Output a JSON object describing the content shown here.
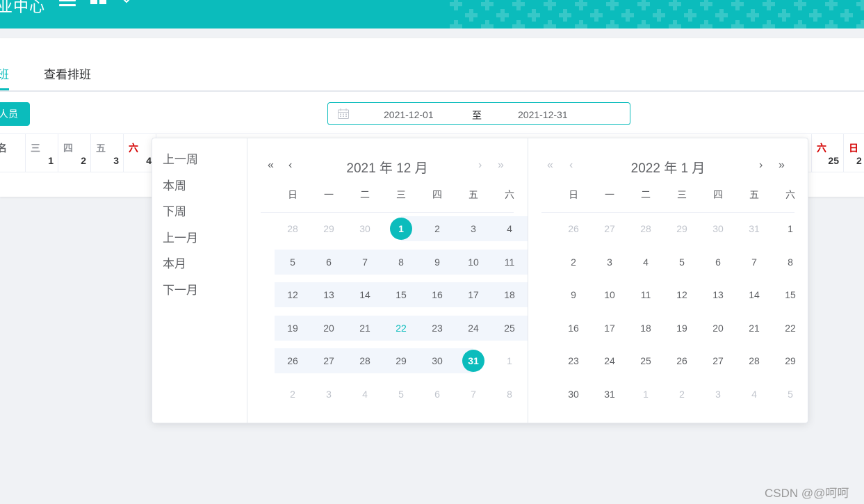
{
  "header": {
    "title": "业中心",
    "menu_icon": "hamburger-menu-icon",
    "grid_icon": "grid-layout-icon",
    "dropdown_icon": "chevron-down-icon",
    "color": "#0bbcbc"
  },
  "tabs": [
    {
      "label": "班",
      "active": true
    },
    {
      "label": "查看排班",
      "active": false
    }
  ],
  "toolbar": {
    "add_button_label": "人员",
    "date_range": {
      "start": "2021-12-01",
      "separator": "至",
      "end": "2021-12-31",
      "icon": "calendar-icon"
    }
  },
  "schedule_header": {
    "name_col": "名",
    "left_days": [
      {
        "weekday": "三",
        "day": "1"
      },
      {
        "weekday": "四",
        "day": "2"
      },
      {
        "weekday": "五",
        "day": "3"
      },
      {
        "weekday": "六",
        "day": "4",
        "weekend": true
      }
    ],
    "right_days": [
      {
        "weekday": "六",
        "day": "25",
        "weekend": true
      },
      {
        "weekday": "日",
        "day": "2",
        "weekend": true
      }
    ]
  },
  "picker": {
    "shortcuts": [
      "上一周",
      "本周",
      "下周",
      "上一月",
      "本月",
      "下一月"
    ],
    "weekdays": [
      "日",
      "一",
      "二",
      "三",
      "四",
      "五",
      "六"
    ],
    "nav": {
      "prev_year": "«",
      "prev_month": "‹",
      "next_month": "›",
      "next_year": "»"
    },
    "left_month": {
      "title": "2021 年 12 月",
      "weeks": [
        [
          "28",
          "29",
          "30",
          "1",
          "2",
          "3",
          "4"
        ],
        [
          "5",
          "6",
          "7",
          "8",
          "9",
          "10",
          "11"
        ],
        [
          "12",
          "13",
          "14",
          "15",
          "16",
          "17",
          "18"
        ],
        [
          "19",
          "20",
          "21",
          "22",
          "23",
          "24",
          "25"
        ],
        [
          "26",
          "27",
          "28",
          "29",
          "30",
          "31",
          "1"
        ],
        [
          "2",
          "3",
          "4",
          "5",
          "6",
          "7",
          "8"
        ]
      ]
    },
    "right_month": {
      "title": "2022 年 1 月",
      "weeks": [
        [
          "26",
          "27",
          "28",
          "29",
          "30",
          "31",
          "1"
        ],
        [
          "2",
          "3",
          "4",
          "5",
          "6",
          "7",
          "8"
        ],
        [
          "9",
          "10",
          "11",
          "12",
          "13",
          "14",
          "15"
        ],
        [
          "16",
          "17",
          "18",
          "19",
          "20",
          "21",
          "22"
        ],
        [
          "23",
          "24",
          "25",
          "26",
          "27",
          "28",
          "29"
        ],
        [
          "30",
          "31",
          "1",
          "2",
          "3",
          "4",
          "5"
        ]
      ]
    }
  },
  "watermark": "CSDN @@呵呵"
}
